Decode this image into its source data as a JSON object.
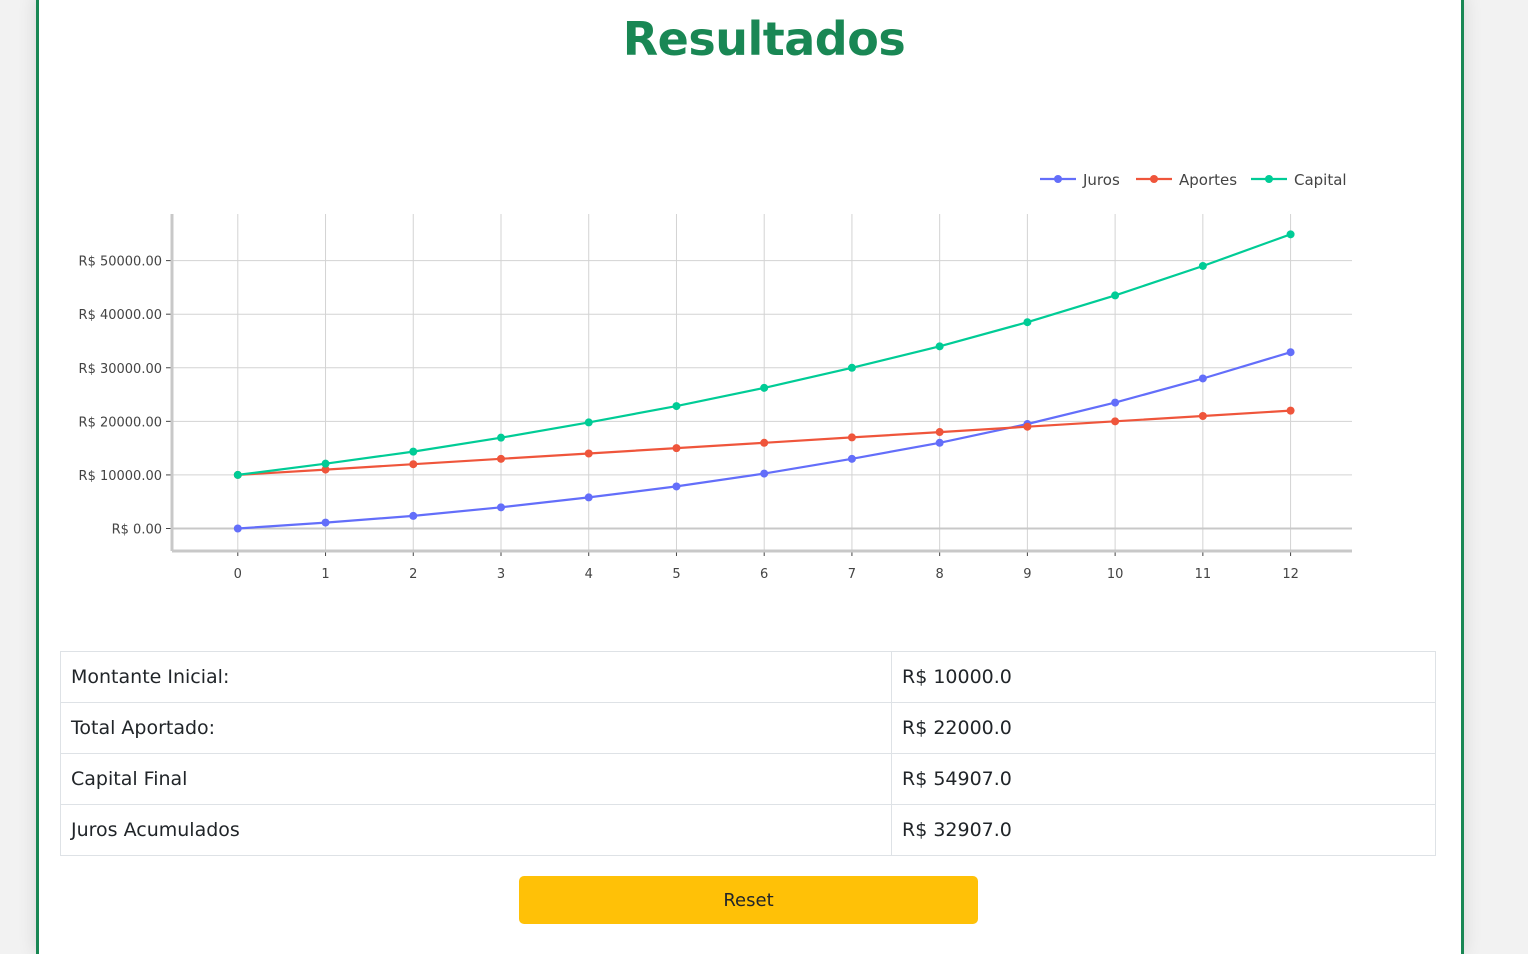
{
  "page": {
    "title": "Resultados"
  },
  "chart_data": {
    "type": "line",
    "x": [
      0,
      1,
      2,
      3,
      4,
      5,
      6,
      7,
      8,
      9,
      10,
      11,
      12
    ],
    "series": [
      {
        "name": "Juros",
        "color": "#636efa",
        "values": [
          0,
          1100,
          2350,
          3950,
          5800,
          7850,
          10250,
          13000,
          16000,
          19500,
          23500,
          28000,
          32907
        ]
      },
      {
        "name": "Aportes",
        "color": "#ef553b",
        "values": [
          10000,
          11000,
          12000,
          13000,
          14000,
          15000,
          16000,
          17000,
          18000,
          19000,
          20000,
          21000,
          22000
        ]
      },
      {
        "name": "Capital",
        "color": "#00cc96",
        "values": [
          10000,
          12100,
          14350,
          16950,
          19800,
          22850,
          26250,
          30000,
          34000,
          38500,
          43500,
          49000,
          54907
        ]
      }
    ],
    "y_ticks": [
      {
        "value": 0,
        "label": "R$ 0.00"
      },
      {
        "value": 10000,
        "label": "R$ 10000.00"
      },
      {
        "value": 20000,
        "label": "R$ 20000.00"
      },
      {
        "value": 30000,
        "label": "R$ 30000.00"
      },
      {
        "value": 40000,
        "label": "R$ 40000.00"
      },
      {
        "value": 50000,
        "label": "R$ 50000.00"
      }
    ],
    "xlim": [
      -0.75,
      12.7
    ],
    "ylim": [
      -4200,
      58700
    ],
    "grid": true,
    "legend": "top-right",
    "title": "",
    "xlabel": "",
    "ylabel": ""
  },
  "summary": {
    "rows": [
      {
        "label": "Montante Inicial:",
        "value": "R$ 10000.0"
      },
      {
        "label": "Total Aportado:",
        "value": "R$ 22000.0"
      },
      {
        "label": "Capital Final",
        "value": "R$ 54907.0"
      },
      {
        "label": "Juros Acumulados",
        "value": "R$ 32907.0"
      }
    ]
  },
  "actions": {
    "reset_label": "Reset"
  }
}
